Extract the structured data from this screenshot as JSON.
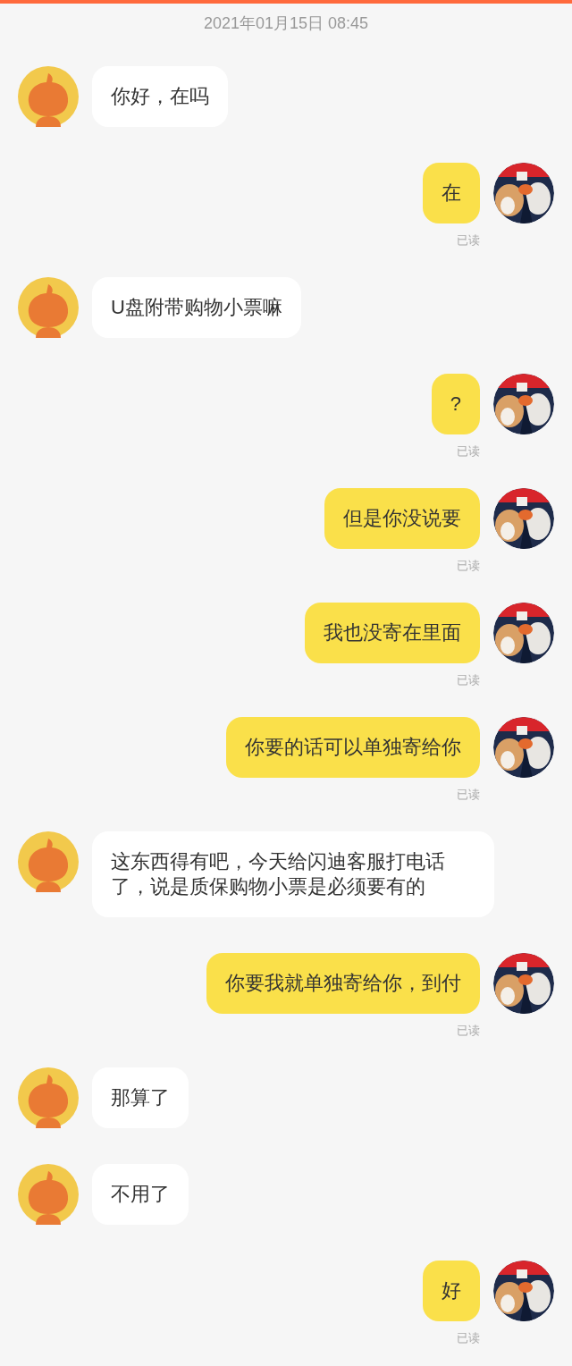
{
  "timestamp": "2021年01月15日 08:45",
  "messages": [
    {
      "kind": "received",
      "text": "你好，在吗"
    },
    {
      "kind": "sent",
      "text": "在",
      "status": "已读"
    },
    {
      "kind": "received",
      "text": "U盘附带购物小票嘛"
    },
    {
      "kind": "sent",
      "text": "?",
      "status": "已读"
    },
    {
      "kind": "sent",
      "text": "但是你没说要",
      "status": "已读"
    },
    {
      "kind": "sent",
      "text": "我也没寄在里面",
      "status": "已读"
    },
    {
      "kind": "sent",
      "text": "你要的话可以单独寄给你",
      "status": "已读"
    },
    {
      "kind": "received",
      "text": "这东西得有吧，今天给闪迪客服打电话了，说是质保购物小票是必须要有的"
    },
    {
      "kind": "sent",
      "text": "你要我就单独寄给你，到付",
      "status": "已读"
    },
    {
      "kind": "received",
      "text": "那算了"
    },
    {
      "kind": "received",
      "text": "不用了"
    },
    {
      "kind": "sent",
      "text": "好",
      "status": "已读"
    }
  ]
}
